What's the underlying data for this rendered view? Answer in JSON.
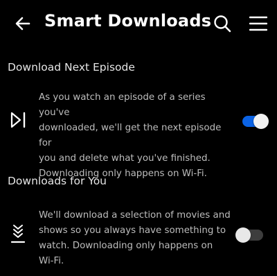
{
  "header": {
    "title": "Smart Downloads",
    "back_icon": "arrow-left-icon",
    "search_icon": "search-icon",
    "menu_icon": "hamburger-menu-icon"
  },
  "sections": [
    {
      "heading": "Download Next Episode",
      "icon": "skip-next-icon",
      "description_lines": [
        "As you watch an episode of a series you've",
        "downloaded, we'll get the next episode for",
        "you and delete what you've finished.",
        "Downloading only happens on Wi-Fi."
      ],
      "toggle_state": "on"
    },
    {
      "heading": "Downloads for You",
      "icon": "downloads-for-you-icon",
      "description_lines": [
        "We'll download a selection of movies and",
        "shows so you always have something to",
        "watch. Downloading only happens on",
        "Wi-Fi."
      ],
      "toggle_state": "off"
    }
  ],
  "colors": {
    "background": "#000000",
    "toggle_on": "#0b63e5",
    "toggle_off": "#3d3d3d",
    "text_primary": "#ffffff",
    "text_secondary": "#bdbdbd"
  }
}
